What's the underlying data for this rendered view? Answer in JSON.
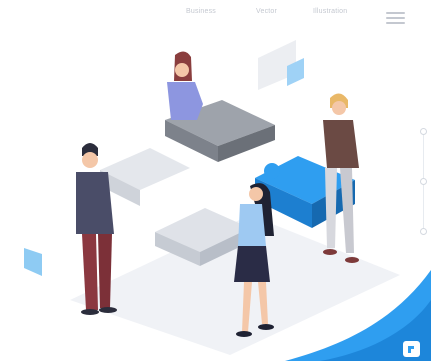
{
  "nav": {
    "links": [
      "Business",
      "Vector",
      "Illustration"
    ],
    "menu_icon": "hamburger-menu-icon"
  },
  "scroll_indicator": {
    "dot_count": 3,
    "dot_color": "#d4d9e0"
  },
  "illustration": {
    "subject": "team-assembling-puzzle-pieces-icon",
    "accent_color": "#2f9ef0",
    "puzzle_dark": "#8e939c",
    "puzzle_light": "#e4e7ec"
  },
  "corner_logo": {
    "icon": "brand-logo-icon",
    "color": "#2f9ef0"
  }
}
